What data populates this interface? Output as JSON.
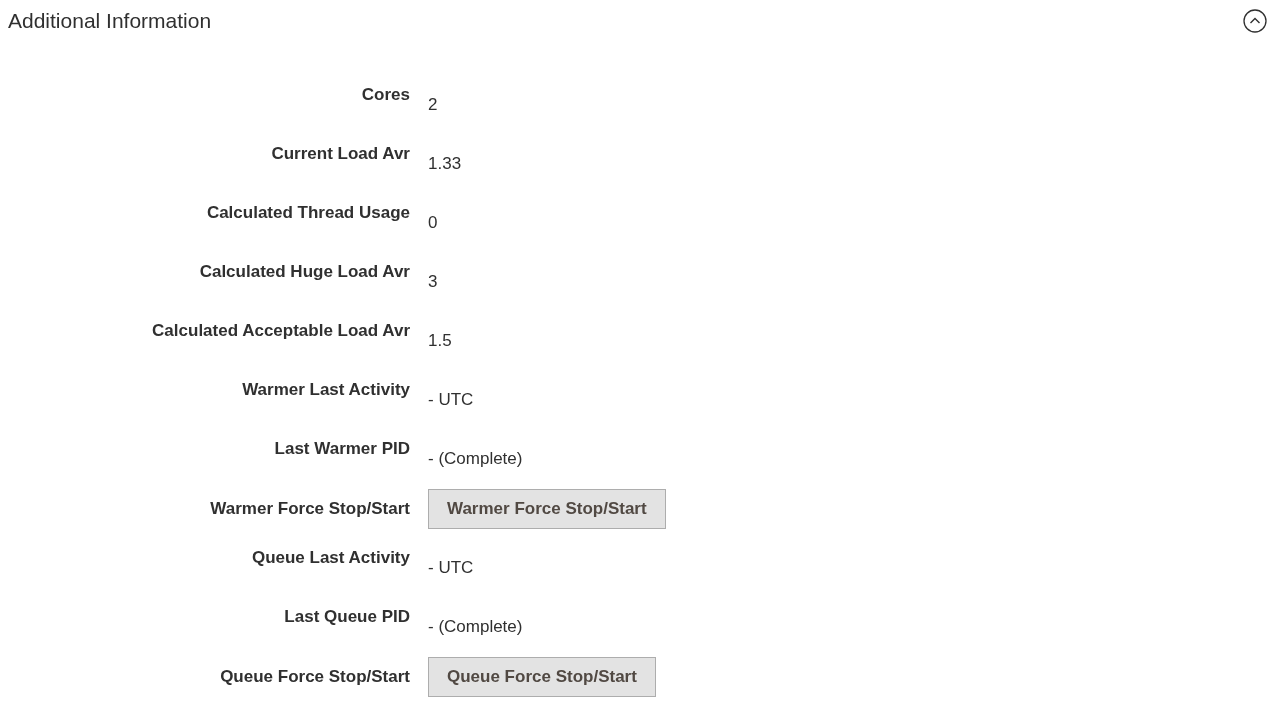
{
  "section": {
    "title": "Additional Information",
    "expanded": true
  },
  "rows": [
    {
      "kind": "text",
      "label": "Cores",
      "value": "2"
    },
    {
      "kind": "text",
      "label": "Current Load Avr",
      "value": "1.33"
    },
    {
      "kind": "text",
      "label": "Calculated Thread Usage",
      "value": "0"
    },
    {
      "kind": "text",
      "label": "Calculated Huge Load Avr",
      "value": "3"
    },
    {
      "kind": "text",
      "label": "Calculated Acceptable Load Avr",
      "value": "1.5"
    },
    {
      "kind": "text",
      "label": "Warmer Last Activity",
      "value": "- UTC"
    },
    {
      "kind": "text",
      "label": "Last Warmer PID",
      "value": "- (Complete)"
    },
    {
      "kind": "button",
      "label": "Warmer Force Stop/Start",
      "button": "Warmer Force Stop/Start"
    },
    {
      "kind": "text",
      "label": "Queue Last Activity",
      "value": "- UTC"
    },
    {
      "kind": "text",
      "label": "Last Queue PID",
      "value": "- (Complete)"
    },
    {
      "kind": "button",
      "label": "Queue Force Stop/Start",
      "button": "Queue Force Stop/Start"
    }
  ]
}
